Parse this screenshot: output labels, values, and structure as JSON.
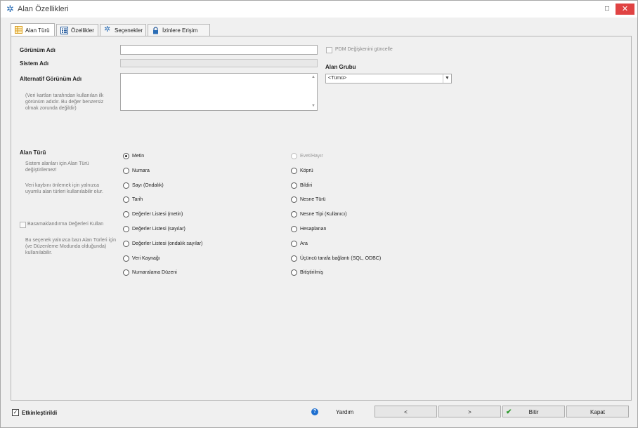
{
  "window": {
    "title": "Alan Özellikleri",
    "maximize_glyph": "□",
    "close_glyph": "✕",
    "title_icon": "gear-icon"
  },
  "tabs": [
    {
      "label": "Alan Türü",
      "icon": "table-icon"
    },
    {
      "label": "Özellikler",
      "icon": "list-icon"
    },
    {
      "label": "Seçenekler",
      "icon": "gear-icon"
    },
    {
      "label": "İzinlere Erişim",
      "icon": "lock-icon"
    }
  ],
  "form": {
    "display_name_label": "Görünüm Adı",
    "display_name_value": "",
    "system_name_label": "Sistem Adı",
    "system_name_value": "",
    "alt_display_name_label": "Alternatif Görünüm Adı",
    "alt_display_name_note": "(Veri kartları tarafından kullanılan ilk görünüm adıdır. Bu değer benzersiz olmak zorunda değildir)",
    "pdm_update_label": "PDM Değişkenini güncelle",
    "field_group_label": "Alan Grubu",
    "field_group_value": "<Tümü>",
    "field_type_label": "Alan Türü",
    "field_type_note1": "Sistem alanları için Alan Türü değiştirilemez!",
    "field_type_note2": "Veri kaybını önlemek için yalnızca uyumlu alan türleri kullanılabilir olur.",
    "cascade_label": "Basamaklandırma Değerleri Kullan",
    "cascade_note": "Bu seçenek yalnızca bazı Alan Türleri için (ve Düzenleme Modunda olduğunda) kullanılabilir."
  },
  "field_types_left": [
    {
      "label": "Metin",
      "selected": true,
      "disabled": false
    },
    {
      "label": "Numara",
      "selected": false,
      "disabled": false
    },
    {
      "label": "Sayı (Ondalık)",
      "selected": false,
      "disabled": false
    },
    {
      "label": "Tarih",
      "selected": false,
      "disabled": false
    },
    {
      "label": "Değerler Listesi (metin)",
      "selected": false,
      "disabled": false
    },
    {
      "label": "Değerler Listesi (sayılar)",
      "selected": false,
      "disabled": false
    },
    {
      "label": "Değerler Listesi (ondalık sayılar)",
      "selected": false,
      "disabled": false
    },
    {
      "label": "Veri Kaynağı",
      "selected": false,
      "disabled": false
    },
    {
      "label": "Numaralama Düzeni",
      "selected": false,
      "disabled": false
    }
  ],
  "field_types_right": [
    {
      "label": "Evet/Hayır",
      "selected": false,
      "disabled": true
    },
    {
      "label": "Köprü",
      "selected": false,
      "disabled": false
    },
    {
      "label": "Bildiri",
      "selected": false,
      "disabled": false
    },
    {
      "label": "Nesne Türü",
      "selected": false,
      "disabled": false
    },
    {
      "label": "Nesne Tipi (Kullanıcı)",
      "selected": false,
      "disabled": false
    },
    {
      "label": "Hesaplanan",
      "selected": false,
      "disabled": false
    },
    {
      "label": "Ara",
      "selected": false,
      "disabled": false
    },
    {
      "label": "Üçüncü tarafa bağlantı (SQL, ODBC)",
      "selected": false,
      "disabled": false
    },
    {
      "label": "Bitiştirilmiş",
      "selected": false,
      "disabled": false
    }
  ],
  "footer": {
    "enabled_label": "Etkinleştirildi",
    "enabled_checked": true,
    "help_label": "Yardım",
    "prev_label": "<",
    "next_label": ">",
    "finish_label": "Bitir",
    "close_label": "Kapat"
  }
}
